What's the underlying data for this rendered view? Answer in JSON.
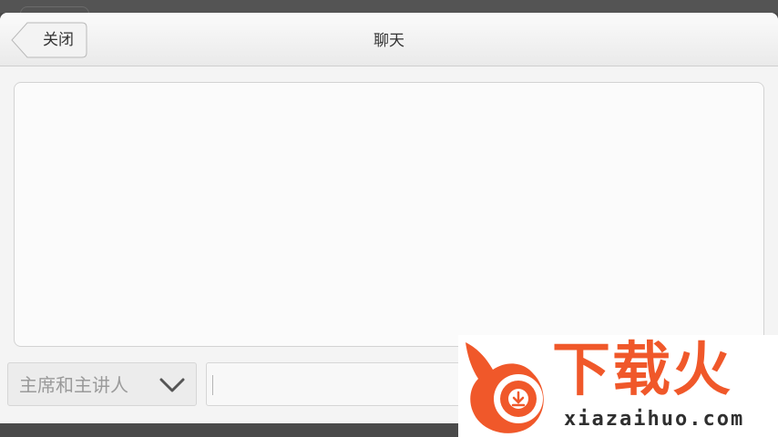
{
  "header": {
    "close_label": "关闭",
    "title": "聊天"
  },
  "composer": {
    "recipient_selected": "主席和主讲人",
    "message_value": ""
  },
  "watermark": {
    "title": "下载火",
    "url": "xiazaihuo.com"
  },
  "colors": {
    "accent": "#f0582a",
    "panel_bg": "#f4f4f4",
    "frame_bg": "#4a4a4a"
  },
  "icons": {
    "back": "back-arrow-icon",
    "dropdown": "chevron-down-icon",
    "watermark_logo": "flame-download-icon"
  }
}
